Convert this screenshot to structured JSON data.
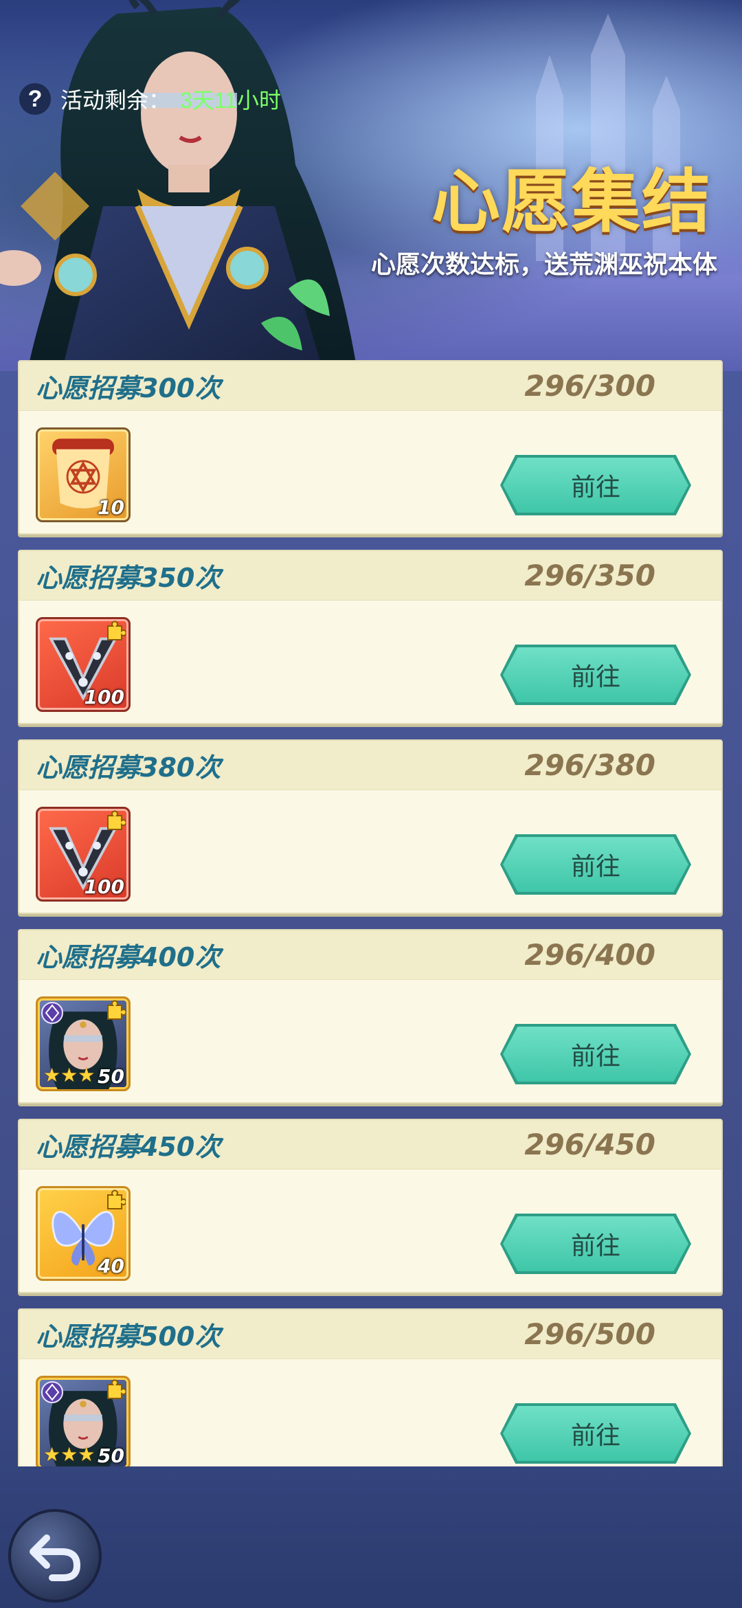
{
  "header": {
    "help_icon": "question-mark-icon",
    "time_label": "活动剩余：",
    "time_value": "3天11小时",
    "title": "心愿集结",
    "subtitle": "心愿次数达标，送荒渊巫祝本体"
  },
  "tasks": [
    {
      "title": "心愿招募300次",
      "progress": "296/300",
      "reward_count": "10",
      "reward_icon": "scroll-icon",
      "button": "前往"
    },
    {
      "title": "心愿招募350次",
      "progress": "296/350",
      "reward_count": "100",
      "reward_icon": "amulet-fragment-icon",
      "button": "前往"
    },
    {
      "title": "心愿招募380次",
      "progress": "296/380",
      "reward_count": "100",
      "reward_icon": "amulet-fragment-icon",
      "button": "前往"
    },
    {
      "title": "心愿招募400次",
      "progress": "296/400",
      "reward_count": "50",
      "reward_icon": "hero-fragment-icon",
      "button": "前往"
    },
    {
      "title": "心愿招募450次",
      "progress": "296/450",
      "reward_count": "40",
      "reward_icon": "butterfly-fragment-icon",
      "button": "前往"
    },
    {
      "title": "心愿招募500次",
      "progress": "296/500",
      "reward_count": "50",
      "reward_icon": "hero-fragment-icon",
      "button": "前往"
    }
  ],
  "footer": {
    "back_icon": "back-arrow-icon"
  },
  "colors": {
    "accent_teal": "#3fc6a8",
    "title_gold": "#ffd95a",
    "timer_green": "#7dff6a",
    "card_title_blue": "#1f6f8b"
  }
}
